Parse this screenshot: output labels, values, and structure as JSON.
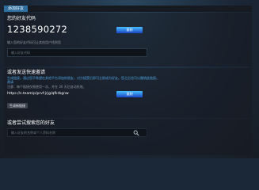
{
  "tabs": {
    "active_label": "添加好友"
  },
  "friend_code": {
    "title": "您的好友代码",
    "code": "1238590272",
    "copy_button": "复制",
    "hint": "输入您的好友代码可让其他用户找到您",
    "input_placeholder": "输入好友代码"
  },
  "invite": {
    "title": "或者发送快速邀请",
    "desc_line1": "生成链接，通过您不希望在其他平台添加的朋友，对方接受后即可立即成为好友。您之后也可以撤销此链接。",
    "desc_line2": "邀请",
    "expiry_note": "注意：每个链接仅限使用一次，并在 30 天后自动失效。",
    "link": "https://s.team/p/prvf-jrjg/qfkrbgnw",
    "copy_button": "复制",
    "generate_button": "生成新链接"
  },
  "search": {
    "title": "或者尝试搜索您的好友",
    "placeholder": "输入好友的名称或个人资料名称"
  },
  "colors": {
    "background": "#1b2838",
    "accent_blue": "#1a9fff",
    "tab_active": "#2e6fa0"
  }
}
